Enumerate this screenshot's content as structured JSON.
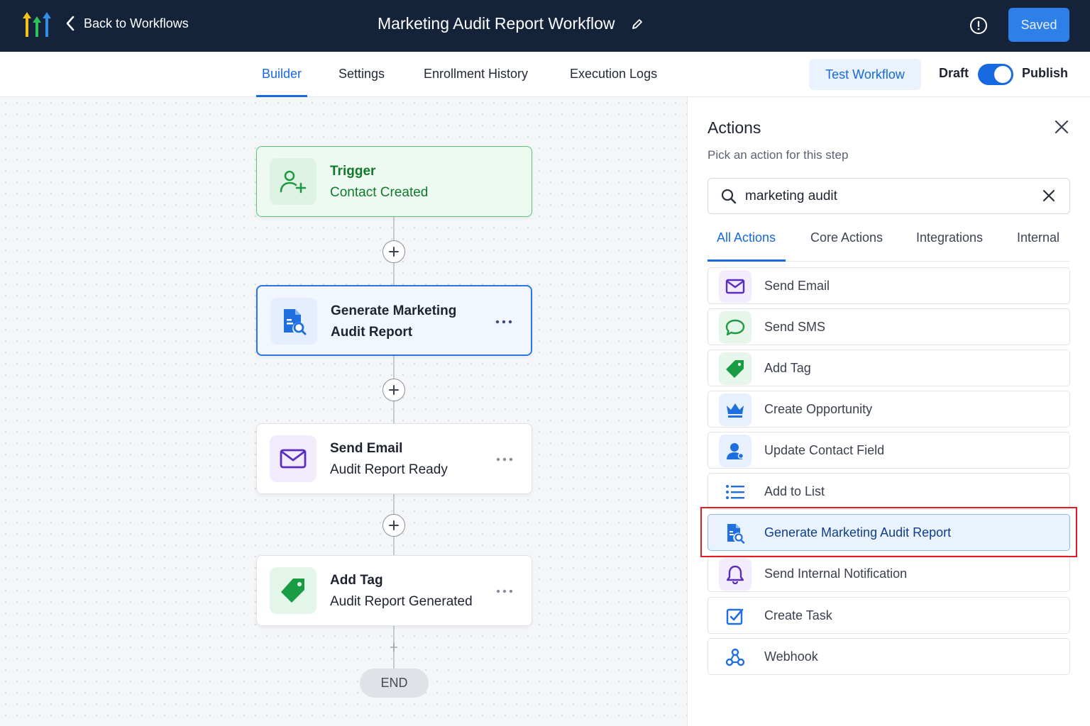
{
  "topbar": {
    "back_label": "Back to Workflows",
    "workflow_title": "Marketing Audit Report Workflow",
    "saved_label": "Saved",
    "colors": {
      "bg": "#14223a",
      "saved": "#2f7fe8"
    }
  },
  "tabs": {
    "items": [
      {
        "label": "Builder",
        "active": true
      },
      {
        "label": "Settings"
      },
      {
        "label": "Enrollment History"
      },
      {
        "label": "Execution Logs"
      }
    ],
    "test_label": "Test Workflow",
    "draft_label": "Draft",
    "publish_label": "Publish",
    "publish_toggle_on": true
  },
  "workflow": {
    "nodes": [
      {
        "title": "Trigger",
        "subtitle": "Contact Created",
        "icon": "user-plus-icon"
      },
      {
        "title": "Generate Marketing",
        "title2": "Audit Report",
        "icon": "report-search-icon"
      },
      {
        "title": "Send Email",
        "subtitle": "Audit Report Ready",
        "icon": "mail-icon"
      },
      {
        "title": "Add Tag",
        "subtitle": "Audit Report Generated",
        "icon": "tag-icon"
      }
    ],
    "end_label": "END"
  },
  "panel": {
    "title": "Actions",
    "subtitle": "Pick an action for this step",
    "search_value": "marketing audit",
    "tabs": [
      {
        "label": "All Actions",
        "active": true
      },
      {
        "label": "Core Actions"
      },
      {
        "label": "Integrations"
      },
      {
        "label": "Internal"
      }
    ],
    "actions": [
      {
        "label": "Send Email",
        "icon": "mail-icon"
      },
      {
        "label": "Send SMS",
        "icon": "chat-bubble-icon"
      },
      {
        "label": "Add Tag",
        "icon": "tag-icon"
      },
      {
        "label": "Create Opportunity",
        "icon": "crown-icon"
      },
      {
        "label": "Update Contact Field",
        "icon": "person-icon"
      },
      {
        "label": "Add to List",
        "icon": "list-icon"
      },
      {
        "label": "Generate Marketing Audit Report",
        "icon": "report-search-icon",
        "highlighted": true
      },
      {
        "label": "Send Internal Notification",
        "icon": "bell-icon"
      },
      {
        "label": "Create Task",
        "icon": "checkbox-icon"
      },
      {
        "label": "Webhook",
        "icon": "webhook-icon"
      }
    ]
  }
}
